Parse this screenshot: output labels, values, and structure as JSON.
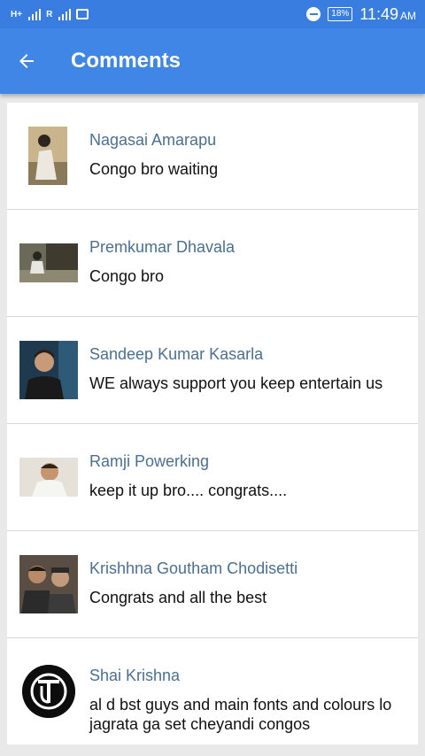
{
  "status_bar": {
    "network_label_1": "H+",
    "network_label_2": "R",
    "battery": "18%",
    "time": "11:49",
    "ampm": "AM",
    "icons": [
      "signal-icon",
      "signal-icon",
      "image-icon",
      "do-not-disturb-icon",
      "battery-icon"
    ]
  },
  "app_bar": {
    "title": "Comments",
    "back_icon": "arrow-left-icon",
    "color": "#3f86e6"
  },
  "comments": [
    {
      "name": "Nagasai Amarapu",
      "text": "Congo bro waiting"
    },
    {
      "name": "Premkumar Dhavala",
      "text": "Congo bro"
    },
    {
      "name": "Sandeep Kumar Kasarla",
      "text": "WE always support you keep entertain us"
    },
    {
      "name": "Ramji Powerking",
      "text": "keep it up bro.... congrats...."
    },
    {
      "name": "Krishhna Goutham Chodisetti",
      "text": "Congrats and all the best"
    },
    {
      "name": "Shai Krishna",
      "text": "al d bst guys and main fonts and colours lo jagrata ga set cheyandi congos"
    }
  ],
  "colors": {
    "status_bar": "#3a7de0",
    "name_text": "#4b6f8f",
    "background": "#e9e9e9"
  }
}
